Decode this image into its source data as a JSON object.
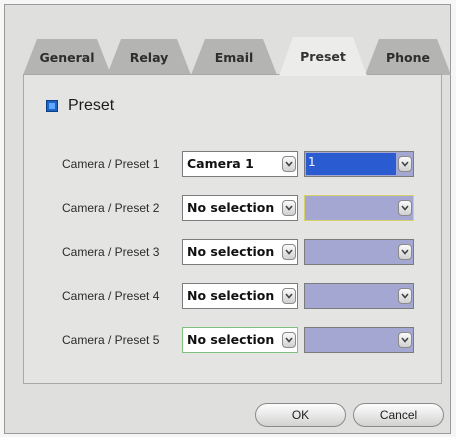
{
  "tabs": [
    {
      "label": "General",
      "active": false
    },
    {
      "label": "Relay",
      "active": false
    },
    {
      "label": "Email",
      "active": false
    },
    {
      "label": "Preset",
      "active": true
    },
    {
      "label": "Phone",
      "active": false
    }
  ],
  "section": {
    "title": "Preset",
    "icon": "checkbox-icon"
  },
  "rows": [
    {
      "label": "Camera / Preset 1",
      "camera": "Camera 1",
      "preset": "1"
    },
    {
      "label": "Camera / Preset 2",
      "camera": "No selection",
      "preset": ""
    },
    {
      "label": "Camera / Preset 3",
      "camera": "No selection",
      "preset": ""
    },
    {
      "label": "Camera / Preset 4",
      "camera": "No selection",
      "preset": ""
    },
    {
      "label": "Camera / Preset 5",
      "camera": "No selection",
      "preset": ""
    }
  ],
  "buttons": {
    "ok": "OK",
    "cancel": "Cancel"
  },
  "colors": {
    "dialog_bg": "#dfe0de",
    "tab_inactive": "#b4b5b2",
    "tab_active": "#ecedeb",
    "preset_field": "#a5a7d3",
    "selection": "#2a5bd0",
    "section_icon": "#1f66c4"
  },
  "icons": {
    "dropdown": "chevron-down-icon"
  }
}
